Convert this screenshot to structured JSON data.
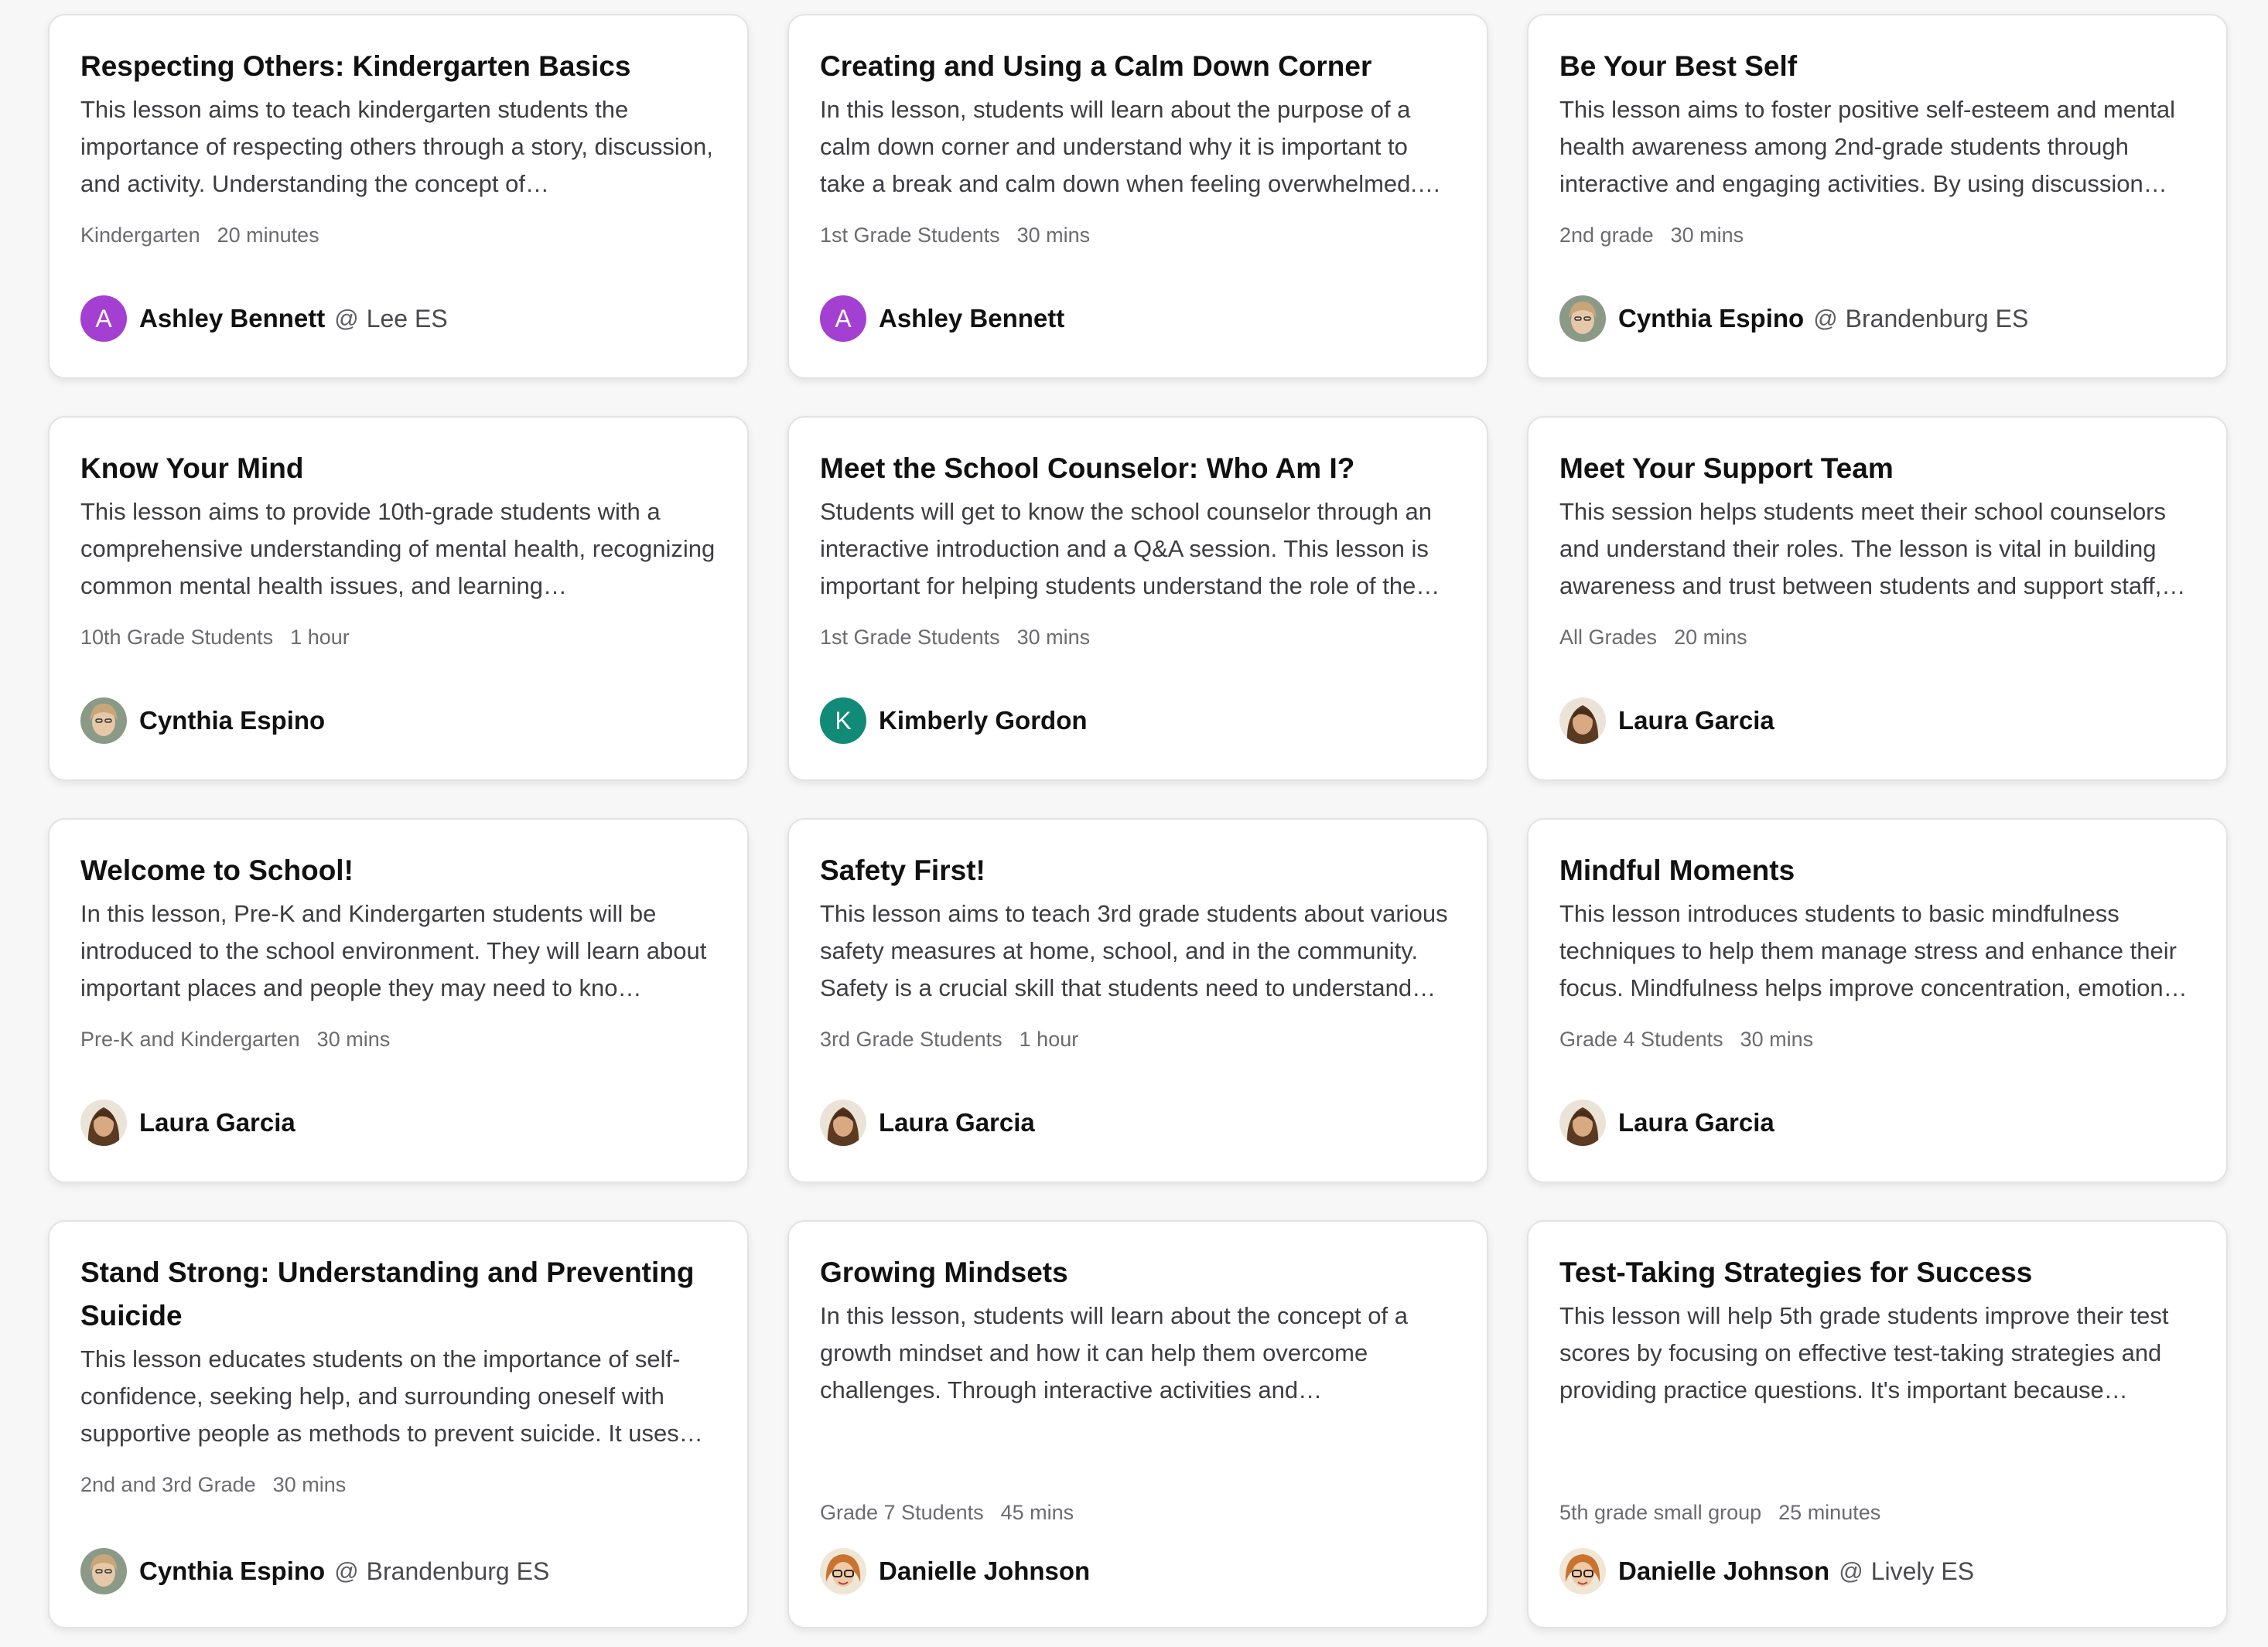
{
  "colors": {
    "avatar_purple": "#a33fd1",
    "avatar_teal": "#128a78"
  },
  "cards": [
    {
      "title": "Respecting Others: Kindergarten Basics",
      "description": "This lesson aims to teach kindergarten students the importance of respecting others through a story, discussion, and activity. Understanding the concept of…",
      "grade": "Kindergarten",
      "duration": "20 minutes",
      "author": "Ashley Bennett",
      "avatar_letter": "A",
      "at": "@",
      "school": "Lee ES"
    },
    {
      "title": "Creating and Using a Calm Down Corner",
      "description": "In this lesson, students will learn about the purpose of a calm down corner and understand why it is important to take a break and calm down when feeling overwhelmed.…",
      "grade": "1st Grade Students",
      "duration": "30 mins",
      "author": "Ashley Bennett",
      "avatar_letter": "A"
    },
    {
      "title": "Be Your Best Self",
      "description": "This lesson aims to foster positive self-esteem and mental health awareness among 2nd-grade students through interactive and engaging activities. By using discussion an…",
      "grade": "2nd grade",
      "duration": "30 mins",
      "author": "Cynthia Espino",
      "at": "@",
      "school": "Brandenburg ES"
    },
    {
      "title": "Know Your Mind",
      "description": "This lesson aims to provide 10th-grade students with a comprehensive understanding of mental health, recognizing common mental health issues, and learning…",
      "grade": "10th Grade Students",
      "duration": "1 hour",
      "author": "Cynthia Espino"
    },
    {
      "title": "Meet the School Counselor: Who Am I?",
      "description": "Students will get to know the school counselor through an interactive introduction and a Q&A session. This lesson is important for helping students understand the role of the…",
      "grade": "1st Grade Students",
      "duration": "30 mins",
      "author": "Kimberly Gordon",
      "avatar_letter": "K"
    },
    {
      "title": "Meet Your Support Team",
      "description": "This session helps students meet their school counselors and understand their roles. The lesson is vital in building awareness and trust between students and support staff,…",
      "grade": "All Grades",
      "duration": "20 mins",
      "author": "Laura Garcia"
    },
    {
      "title": "Welcome to School!",
      "description": "In this lesson, Pre-K and Kindergarten students will be introduced to the school environment. They will learn about important places and people they may need to kno…",
      "grade": "Pre-K and Kindergarten",
      "duration": "30 mins",
      "author": "Laura Garcia"
    },
    {
      "title": "Safety First!",
      "description": "This lesson aims to teach 3rd grade students about various safety measures at home, school, and in the community. Safety is a crucial skill that students need to understand…",
      "grade": "3rd Grade Students",
      "duration": "1 hour",
      "author": "Laura Garcia"
    },
    {
      "title": "Mindful Moments",
      "description": "This lesson introduces students to basic mindfulness techniques to help them manage stress and enhance their focus. Mindfulness helps improve concentration, emotion…",
      "grade": "Grade 4 Students",
      "duration": "30 mins",
      "author": "Laura Garcia"
    },
    {
      "title": "Stand Strong: Understanding and Preventing Suicide",
      "description": "This lesson educates students on the importance of self-confidence, seeking help, and surrounding oneself with supportive people as methods to prevent suicide. It uses a…",
      "grade": "2nd and 3rd Grade",
      "duration": "30 mins",
      "author": "Cynthia Espino",
      "at": "@",
      "school": "Brandenburg ES"
    },
    {
      "title": "Growing Mindsets",
      "description": "In this lesson, students will learn about the concept of a growth mindset and how it can help them overcome challenges. Through interactive activities and discussions,…",
      "grade": "Grade 7 Students",
      "duration": "45 mins",
      "author": "Danielle Johnson"
    },
    {
      "title": "Test-Taking Strategies for Success",
      "description": "This lesson will help 5th grade students improve their test scores by focusing on effective test-taking strategies and providing practice questions. It's important because…",
      "grade": "5th grade small group",
      "duration": "25 minutes",
      "author": "Danielle Johnson",
      "at": "@",
      "school": "Lively ES"
    }
  ]
}
